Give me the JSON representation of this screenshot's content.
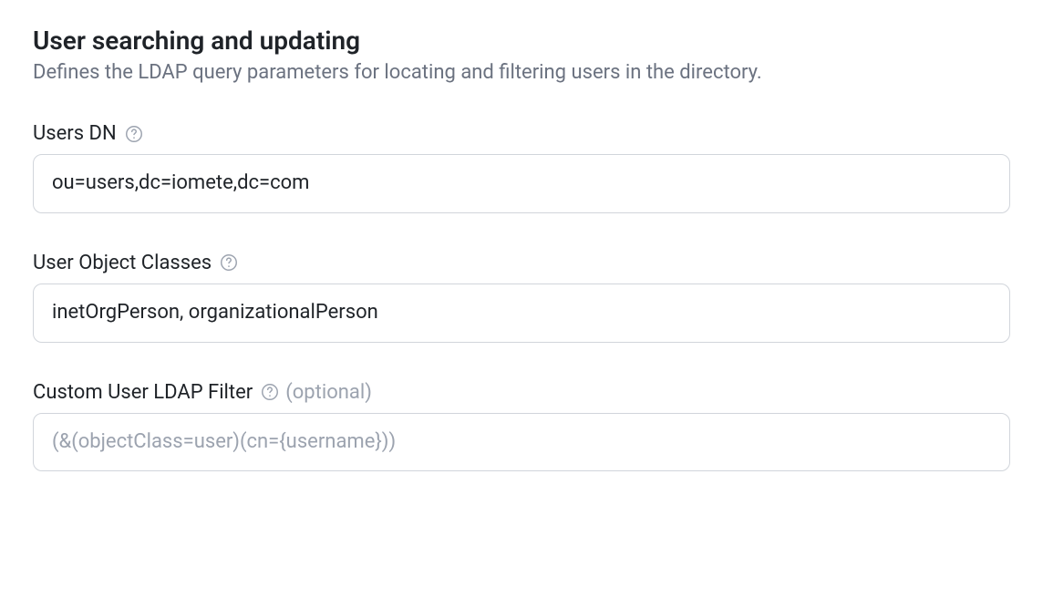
{
  "section": {
    "title": "User searching and updating",
    "description": "Defines the LDAP query parameters for locating and filtering users in the directory."
  },
  "fields": {
    "usersDn": {
      "label": "Users DN",
      "value": "ou=users,dc=iomete,dc=com",
      "placeholder": ""
    },
    "userObjectClasses": {
      "label": "User Object Classes",
      "value": "inetOrgPerson, organizationalPerson",
      "placeholder": ""
    },
    "customFilter": {
      "label": "Custom User LDAP Filter",
      "optional": "(optional)",
      "value": "",
      "placeholder": "(&(objectClass=user)(cn={username}))"
    }
  }
}
